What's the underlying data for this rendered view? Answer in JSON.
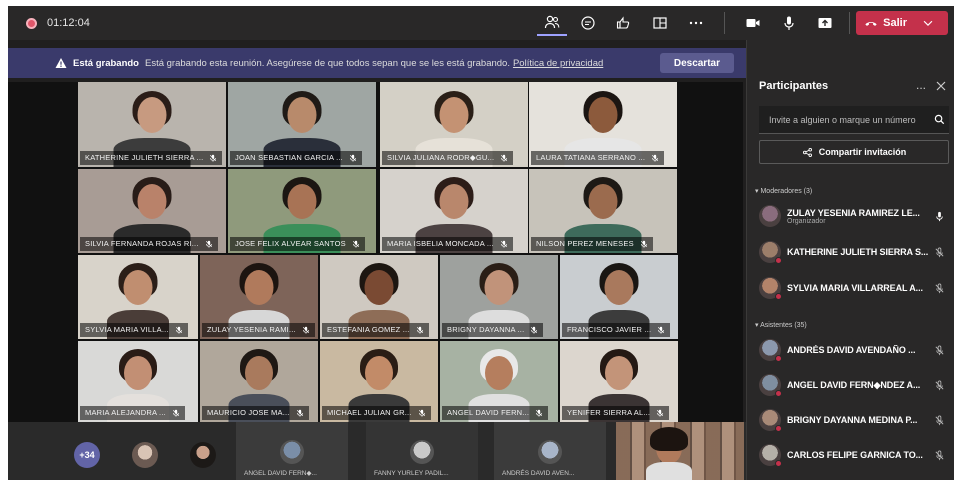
{
  "topbar": {
    "timer": "01:12:04",
    "leave_label": "Salir",
    "icons": [
      "participants-icon",
      "chat-icon",
      "reactions-icon",
      "rooms-icon",
      "more-icon",
      "camera-icon",
      "mic-icon",
      "share-icon",
      "leave-icon"
    ]
  },
  "banner": {
    "bold": "Está grabando",
    "text": "Está grabando esta reunión. Asegúrese de que todos sepan que se les está grabando.",
    "link": "Política de privacidad",
    "dismiss": "Descartar"
  },
  "gallery": {
    "tiles": [
      {
        "name": "KATHERINE JULIETH SIERRA ...",
        "bg": "#b9b4ad",
        "skin": "#c79a80",
        "shirt": "#3c3c3c",
        "hair": "#2b1d18"
      },
      {
        "name": "JOAN SEBASTIAN GARCIA ...",
        "bg": "#9fa6a3",
        "skin": "#b88a6b",
        "shirt": "#2a2f3a",
        "hair": "#1f1a16"
      },
      {
        "name": "SILVIA JULIANA RODR◆GU...",
        "bg": "#d4d0c6",
        "skin": "#c49273",
        "shirt": "#e6e1d8",
        "hair": "#2a1f17"
      },
      {
        "name": "LAURA TATIANA SERRANO ...",
        "bg": "#e5e2dc",
        "skin": "#8c5a3c",
        "shirt": "#e6e6e6",
        "hair": "#1b1512"
      },
      {
        "name": "SILVIA FERNANDA ROJAS RI...",
        "bg": "#a89c95",
        "skin": "#b9826a",
        "shirt": "#2b2b2b",
        "hair": "#281c18"
      },
      {
        "name": "JOSE FELIX ALVEAR SANTOS",
        "bg": "#8f9a7c",
        "skin": "#a87355",
        "shirt": "#3b8f5a",
        "hair": "#1b1612"
      },
      {
        "name": "MARIA ISBELIA MONCADA ...",
        "bg": "#d6d2cc",
        "skin": "#b9876c",
        "shirt": "#4c4242",
        "hair": "#2d1d18"
      },
      {
        "name": "NILSON  PEREZ MENESES",
        "bg": "#c7c3ba",
        "skin": "#9b6b4e",
        "shirt": "#3e6b5b",
        "hair": "#1d1915"
      },
      {
        "name": "SYLVIA MARIA VILLA...",
        "bg": "#d8d3ca",
        "skin": "#c08e70",
        "shirt": "#4a3d38",
        "hair": "#2b1e18"
      },
      {
        "name": "ZULAY YESENIA RAMI...",
        "bg": "#7e6459",
        "skin": "#b07a5c",
        "shirt": "#d7d7d7",
        "hair": "#1c1410"
      },
      {
        "name": "ESTEFANIA  GOMEZ ...",
        "bg": "#cfc9c1",
        "skin": "#7a4a33",
        "shirt": "#8e6d57",
        "hair": "#1d1611"
      },
      {
        "name": "BRIGNY DAYANNA ...",
        "bg": "#9ea19e",
        "skin": "#c1937a",
        "shirt": "#ddd",
        "hair": "#2a1e16"
      },
      {
        "name": "FRANCISCO JAVIER ...",
        "bg": "#c9cdd0",
        "skin": "#a9795d",
        "shirt": "#3c3c3c",
        "hair": "#1a1613"
      },
      {
        "name": "MARIA ALEJANDRA ...",
        "bg": "#d9d9d7",
        "skin": "#c28f74",
        "shirt": "#e4e0dc",
        "hair": "#2a1c16"
      },
      {
        "name": "MAURICIO JOSE MA...",
        "bg": "#b0a79b",
        "skin": "#a97a5d",
        "shirt": "#4a4f5a",
        "hair": "#1e1814"
      },
      {
        "name": "MICHAEL JULIAN GR...",
        "bg": "#c9b9a1",
        "skin": "#c28b68",
        "shirt": "#3a3a3a",
        "hair": "#2a1d15"
      },
      {
        "name": "ANGEL DAVID FERN...",
        "bg": "#a7b2a3",
        "skin": "#b57e5e",
        "shirt": "#e0e0e0",
        "hair": "#e8e8e8"
      },
      {
        "name": "YENIFER  SIERRA AL...",
        "bg": "#dcd6ce",
        "skin": "#c39479",
        "shirt": "#3b3434",
        "hair": "#241914"
      }
    ]
  },
  "strip": {
    "count": "+34",
    "tiles": [
      {
        "name": "ANGEL DAVID FERN◆...",
        "color": "#7a8ea8"
      },
      {
        "name": "FANNY YURLEY PADIL...",
        "color": "#c9c9c9"
      },
      {
        "name": "ANDRÉS DAVID AVEN...",
        "color": "#a8b5c9"
      }
    ]
  },
  "panel": {
    "title": "Participantes",
    "more": "...",
    "invite_placeholder": "Invite a alguien o marque un número",
    "share_label": "Compartir invitación",
    "moderators_label": "Moderadores (3)",
    "attendees_label": "Asistentes (35)",
    "moderators": [
      {
        "name": "ZULAY YESENIA RAMIREZ LE...",
        "sub": "Organizador",
        "color": "#8a6c7d"
      },
      {
        "name": "KATHERINE JULIETH SIERRA S...",
        "sub": "",
        "color": "#9c7e6a"
      },
      {
        "name": "SYLVIA MARIA VILLARREAL A...",
        "sub": "",
        "color": "#b3836a"
      }
    ],
    "attendees": [
      {
        "name": "ANDRÉS DAVID AVENDAÑO ...",
        "color": "#8c98ad"
      },
      {
        "name": "ANGEL DAVID FERN◆NDEZ A...",
        "color": "#7f8ea0"
      },
      {
        "name": "BRIGNY DAYANNA MEDINA P...",
        "color": "#a98a78"
      },
      {
        "name": "CARLOS FELIPE GARNICA TO...",
        "color": "#b5b0a8"
      }
    ]
  }
}
